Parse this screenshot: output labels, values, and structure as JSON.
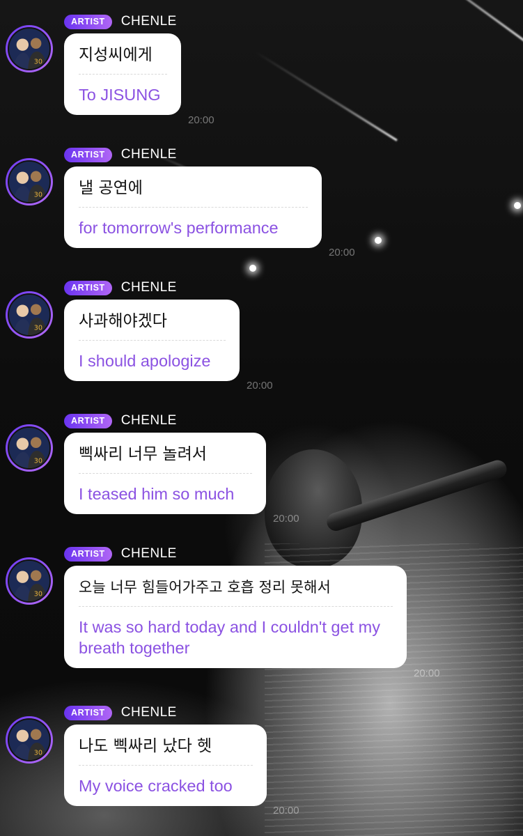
{
  "colors": {
    "badge_start": "#6a34f0",
    "badge_end": "#b066f5",
    "translation_text": "#8b52e2",
    "bubble_bg": "#ffffff"
  },
  "messages": [
    {
      "badge": "ARTIST",
      "sender": "CHENLE",
      "avatar_icon": "artist-avatar-icon",
      "original": "지성씨에게",
      "translation": "To JISUNG",
      "time": "20:00"
    },
    {
      "badge": "ARTIST",
      "sender": "CHENLE",
      "avatar_icon": "artist-avatar-icon",
      "original": "낼 공연에",
      "translation": "for tomorrow's performance",
      "time": "20:00"
    },
    {
      "badge": "ARTIST",
      "sender": "CHENLE",
      "avatar_icon": "artist-avatar-icon",
      "original": "사과해야겠다",
      "translation": "I should apologize",
      "time": "20:00"
    },
    {
      "badge": "ARTIST",
      "sender": "CHENLE",
      "avatar_icon": "artist-avatar-icon",
      "original": "삑싸리 너무 놀려서",
      "translation": "I teased him so much",
      "time": "20:00"
    },
    {
      "badge": "ARTIST",
      "sender": "CHENLE",
      "avatar_icon": "artist-avatar-icon",
      "original": "오늘 너무 힘들어가주고 호흡 정리 못해서",
      "translation": "It was so hard today and I couldn't get my breath together",
      "time": "20:00"
    },
    {
      "badge": "ARTIST",
      "sender": "CHENLE",
      "avatar_icon": "artist-avatar-icon",
      "original": "나도 삑싸리 났다 헷",
      "translation": "My voice cracked too",
      "time": "20:00"
    }
  ]
}
